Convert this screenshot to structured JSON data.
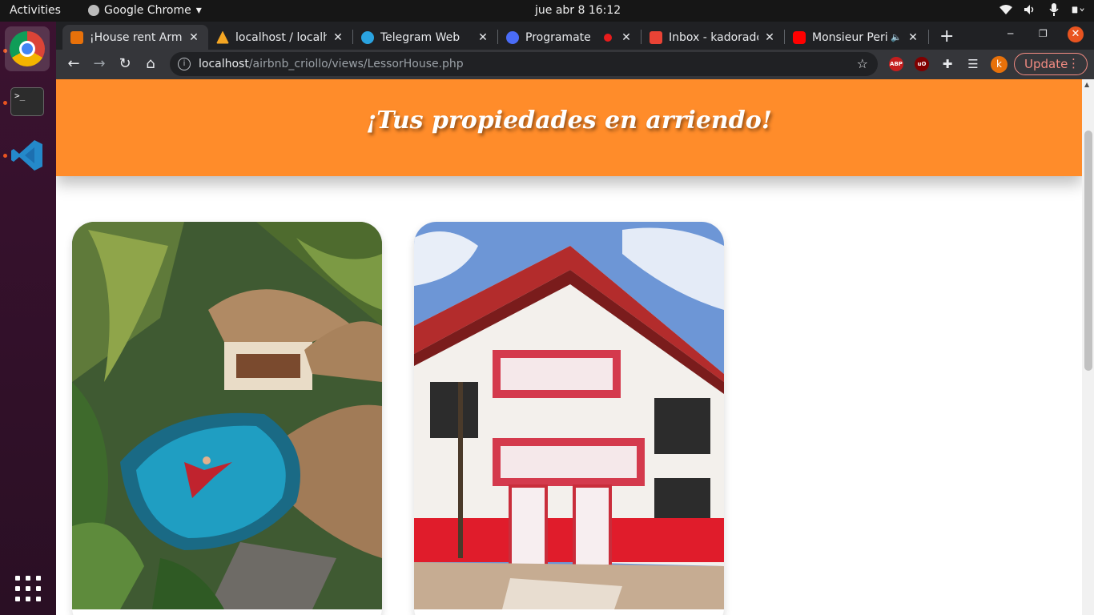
{
  "system_bar": {
    "activities": "Activities",
    "app_menu": "Google Chrome",
    "clock": "jue abr 8  16:12"
  },
  "tabs": [
    {
      "title": "¡House rent Arme",
      "favicon": "house-rent-favicon",
      "color": "#e8710a"
    },
    {
      "title": "localhost / localh",
      "favicon": "phpmyadmin-favicon",
      "color": "#f5a623"
    },
    {
      "title": "Telegram Web",
      "favicon": "telegram-favicon",
      "color": "#2aa3e0"
    },
    {
      "title": "Programate",
      "favicon": "zoom-favicon",
      "color": "#4a6cf7"
    },
    {
      "title": "Inbox - kadorado",
      "favicon": "gmail-favicon",
      "color": "#ea4335"
    },
    {
      "title": "Monsieur Peri",
      "favicon": "youtube-favicon",
      "color": "#ff0000"
    }
  ],
  "toolbar": {
    "url_host": "localhost",
    "url_path": "/airbnb_criollo/views/LessorHouse.php",
    "profile_initial": "k",
    "update_label": "Update",
    "ext_abp": "ABP",
    "ext_ublock": "uO"
  },
  "page": {
    "heading": "¡Tus propiedades en arriendo!",
    "accent_color": "#ff8c2a",
    "cards": [
      {
        "image": "tropical pool villa with thatched roofs"
      },
      {
        "image": "colonial building with red balconies"
      }
    ]
  }
}
